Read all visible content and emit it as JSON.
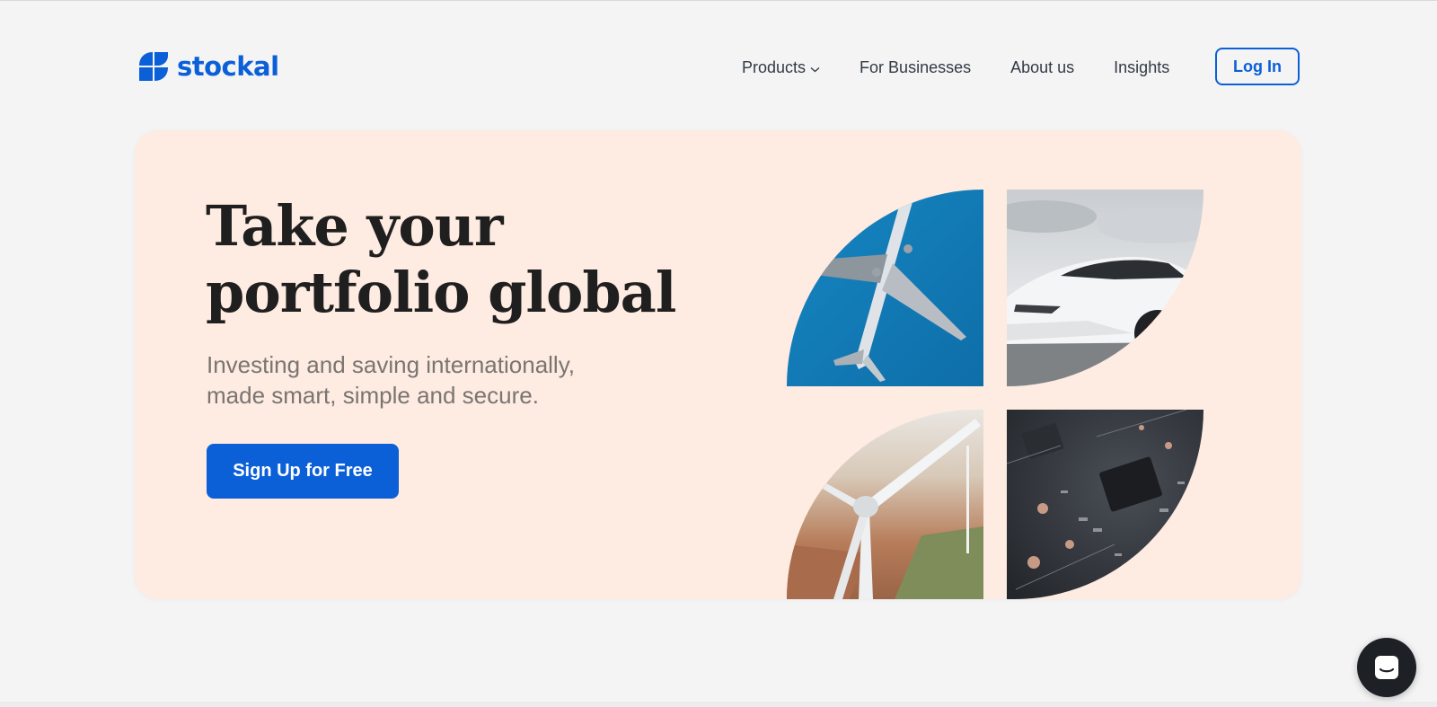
{
  "brand": {
    "name": "stockal",
    "color": "#0b60d8"
  },
  "nav": {
    "items": [
      {
        "label": "Products",
        "has_dropdown": true
      },
      {
        "label": "For Businesses"
      },
      {
        "label": "About us"
      },
      {
        "label": "Insights"
      }
    ],
    "login_label": "Log In"
  },
  "hero": {
    "title_line1": "Take your",
    "title_line2": "portfolio global",
    "subtitle_line1": "Investing and saving internationally,",
    "subtitle_line2": "made smart, simple and secure.",
    "cta_label": "Sign Up for Free",
    "background": "#feebe1",
    "images": [
      "airplane-image",
      "electric-car-image",
      "wind-turbine-image",
      "circuit-board-image"
    ]
  },
  "chat": {
    "icon": "chat-icon"
  }
}
